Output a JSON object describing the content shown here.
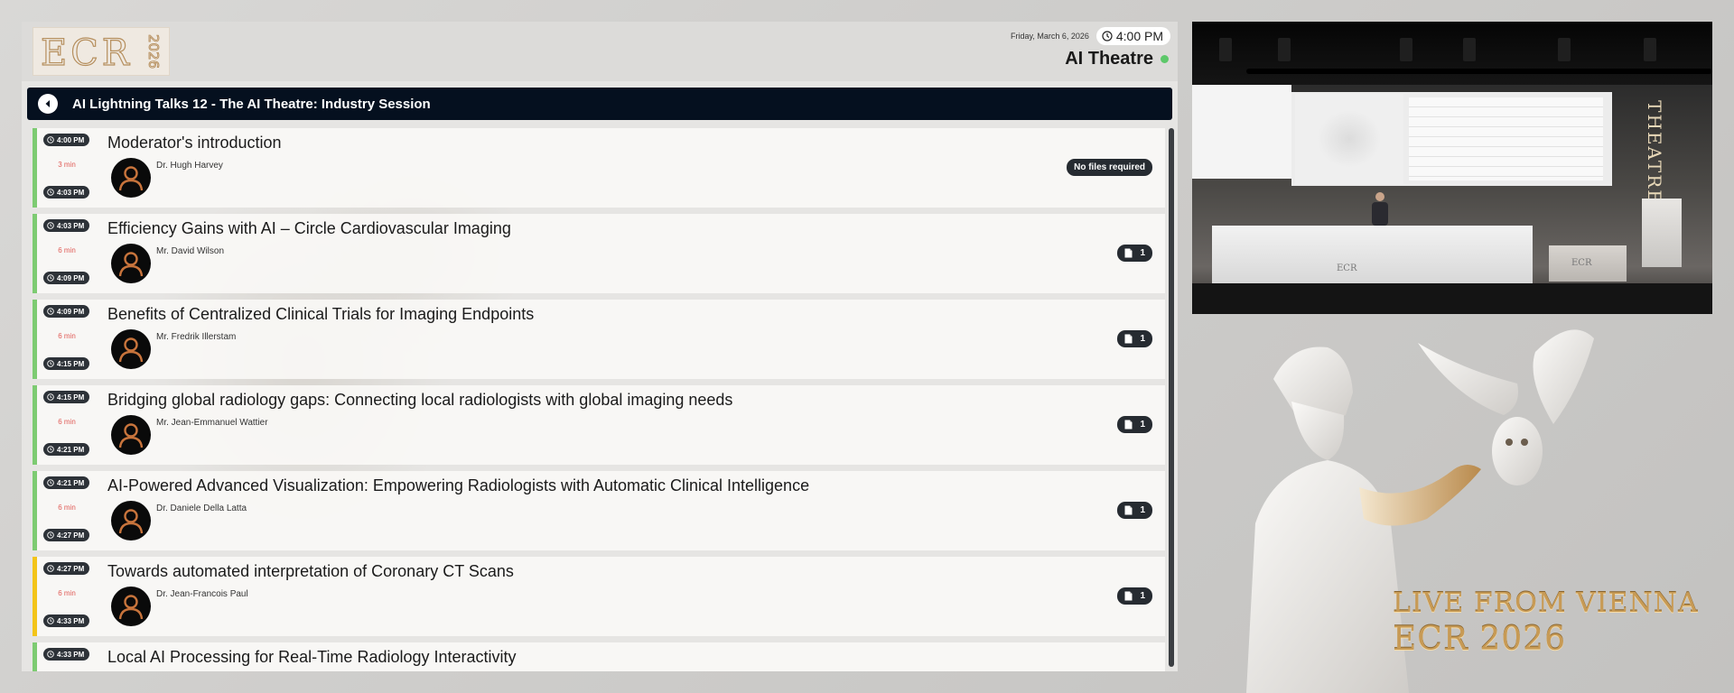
{
  "header": {
    "logo_text": "ECR 2026",
    "date": "Friday, March 6, 2026",
    "time": "4:00 PM",
    "room": "AI Theatre",
    "live_color": "#5dc86a"
  },
  "session": {
    "title": "AI Lightning Talks 12 - The AI Theatre: Industry Session"
  },
  "talks": [
    {
      "start": "4:00 PM",
      "end": "4:03 PM",
      "duration": "3 min",
      "title": "Moderator's introduction",
      "speaker": "Dr. Hugh Harvey",
      "files": "No files required",
      "accent": "green",
      "top": 0
    },
    {
      "start": "4:03 PM",
      "end": "4:09 PM",
      "duration": "6 min",
      "title": "Efficiency Gains with AI – Circle Cardiovascular Imaging",
      "speaker": "Mr. David Wilson",
      "files": "1",
      "accent": "green"
    },
    {
      "start": "4:09 PM",
      "end": "4:15 PM",
      "duration": "6 min",
      "title": "Benefits of Centralized Clinical Trials for Imaging Endpoints",
      "speaker": "Mr. Fredrik Illerstam",
      "files": "1",
      "accent": "green"
    },
    {
      "start": "4:15 PM",
      "end": "4:21 PM",
      "duration": "6 min",
      "title": "Bridging global radiology gaps: Connecting local radiologists with global imaging needs",
      "speaker": "Mr. Jean-Emmanuel Wattier",
      "files": "1",
      "accent": "green"
    },
    {
      "start": "4:21 PM",
      "end": "4:27 PM",
      "duration": "6 min",
      "title": "AI-Powered Advanced Visualization: Empowering Radiologists with Automatic Clinical Intelligence",
      "speaker": "Dr. Daniele Della Latta",
      "files": "1",
      "accent": "green"
    },
    {
      "start": "4:27 PM",
      "end": "4:33 PM",
      "duration": "6 min",
      "title": "Towards automated interpretation of Coronary CT Scans",
      "speaker": "Dr. Jean-Francois Paul",
      "files": "1",
      "accent": "yellow"
    },
    {
      "start": "4:33 PM",
      "title": "Local AI Processing for Real-Time Radiology Interactivity",
      "accent": "green"
    }
  ],
  "video": {
    "sign": "THEATRE",
    "desk_logo": "ECR"
  },
  "branding": {
    "line1": "LIVE FROM VIENNA",
    "line2": "ECR 2026",
    "gold": "#c79a55"
  }
}
